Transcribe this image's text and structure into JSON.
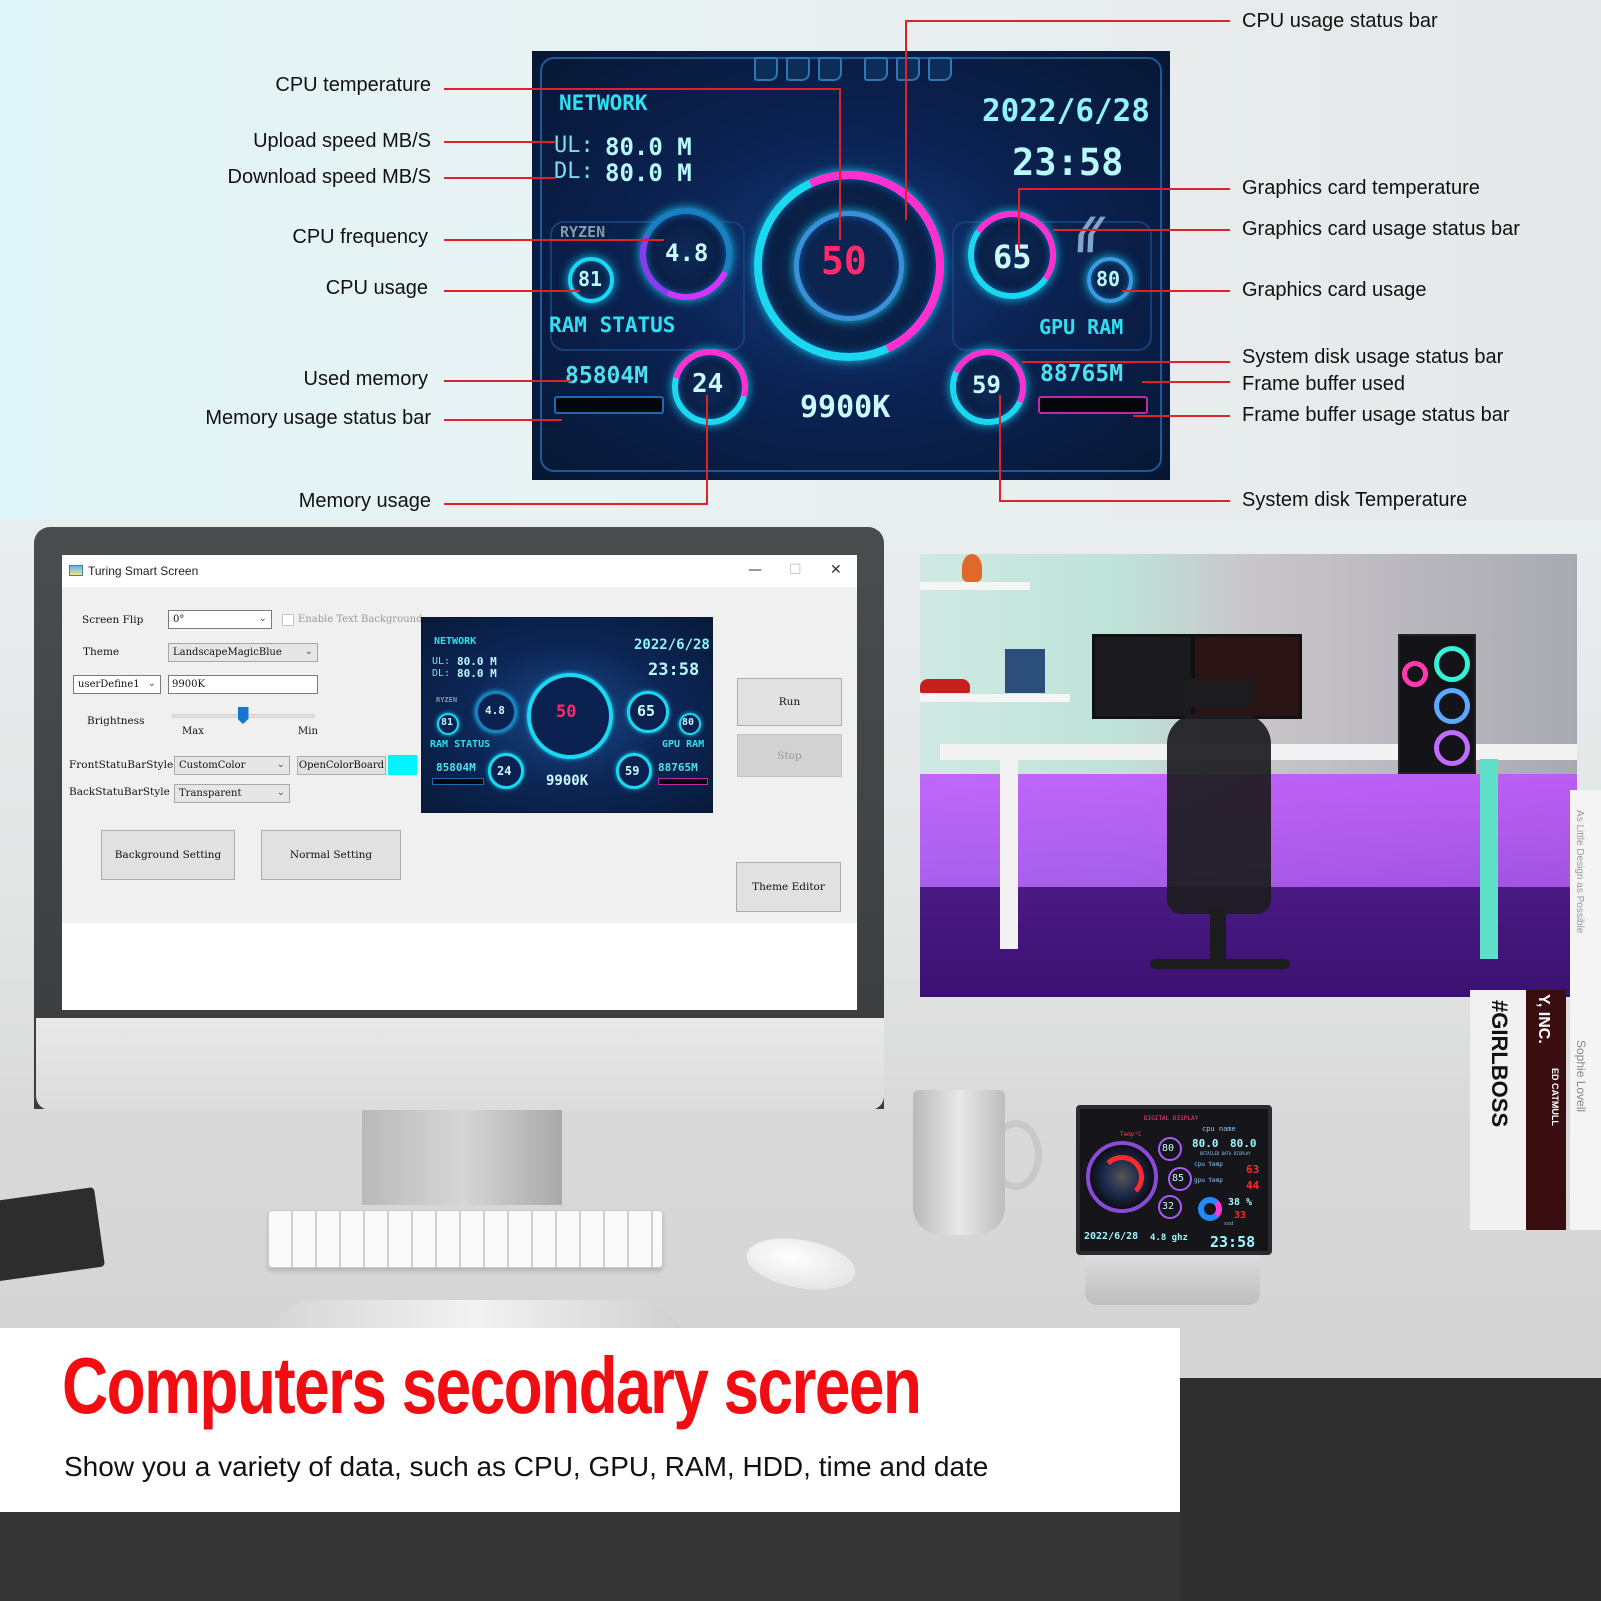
{
  "dashboard": {
    "network_label": "NETWORK",
    "ul_label": "UL:",
    "ul_value": "80.0 M",
    "dl_label": "DL:",
    "dl_value": "80.0 M",
    "date": "2022/6/28",
    "time": "23:58",
    "cpu_brand": "RYZEN",
    "cpu_frequency": "4.8",
    "cpu_usage": "81",
    "cpu_temperature": "50",
    "gpu_temperature": "65",
    "gpu_usage": "80",
    "ram_status_label": "RAM  STATUS",
    "gpu_ram_label": "GPU RAM",
    "used_memory": "85804M",
    "memory_usage": "24",
    "cpu_model": "9900K",
    "disk_temperature": "59",
    "frame_buffer_used": "88765M",
    "colors": {
      "accent_cyan": "#19d8f0",
      "accent_magenta": "#ff2fd0",
      "temp_red": "#ff2a6a"
    }
  },
  "annotations": {
    "left": [
      "CPU temperature",
      "Upload speed MB/S",
      "Download speed MB/S",
      "CPU frequency",
      "CPU usage",
      "Used memory",
      "Memory usage status bar",
      "Memory usage"
    ],
    "right": [
      "CPU usage status bar",
      "Graphics card temperature",
      "Graphics card usage status bar",
      "Graphics card usage",
      "System disk usage status bar",
      "Frame buffer used",
      "Frame buffer usage status bar",
      "System disk Temperature"
    ],
    "line_color": "#e2202a"
  },
  "app": {
    "title": "Turing Smart Screen",
    "minimize_icon": "—",
    "maximize_icon": "☐",
    "close_icon": "✕",
    "screen_flip_label": "Screen Flip",
    "screen_flip_value": "0°",
    "enable_text_bg_label": "Enable Text Background",
    "enable_text_bg_checked": false,
    "theme_label": "Theme",
    "theme_value": "LandscapeMagicBlue",
    "user_define_value": "userDefine1",
    "user_define_text": "9900K",
    "brightness_label": "Brightness",
    "brightness_max": "Max",
    "brightness_min": "Min",
    "brightness_position": 0.5,
    "front_bar_style_label": "FrontStatuBarStyle",
    "front_bar_style_value": "CustomColor",
    "open_color_board": "OpenColorBoard",
    "custom_color": "#00f5ff",
    "back_bar_style_label": "BackStatuBarStyle",
    "back_bar_style_value": "Transparent",
    "background_setting": "Background Setting",
    "normal_setting": "Normal Setting",
    "run": "Run",
    "stop": "Stop",
    "theme_editor": "Theme Editor",
    "chevron": "⌄"
  },
  "device": {
    "header": "DIGITAL DISPLAY",
    "temp_label": "Temp°C",
    "cpu_name_label": "cpu name",
    "value_a": "80.0",
    "value_b": "80.0",
    "detailed_label": "DETAILED DATA DISPLAY",
    "cpu_temp_label": "cpu temp",
    "cpu_temp": "63",
    "gpu_temp_label": "gpu temp",
    "gpu_temp": "44",
    "gauge_1": "80",
    "gauge_2": "85",
    "gauge_3": "32",
    "percent": "38 %",
    "ssd_value": "33",
    "ssd_label": "ssd",
    "date": "2022/6/28",
    "freq": "4.8 ghz",
    "time": "23:58"
  },
  "books": {
    "book_1": "#GIRLBOSS",
    "book_2": "Y, INC.",
    "book_2_author": "ED CATMULL",
    "book_3": "Sophie Lovell",
    "book_3_sub": "As Little Design as Possible"
  },
  "caption": {
    "headline": "Computers secondary screen",
    "subline": "Show you a variety of data, such as CPU, GPU, RAM, HDD, time and date",
    "headline_color": "#f20d12"
  }
}
